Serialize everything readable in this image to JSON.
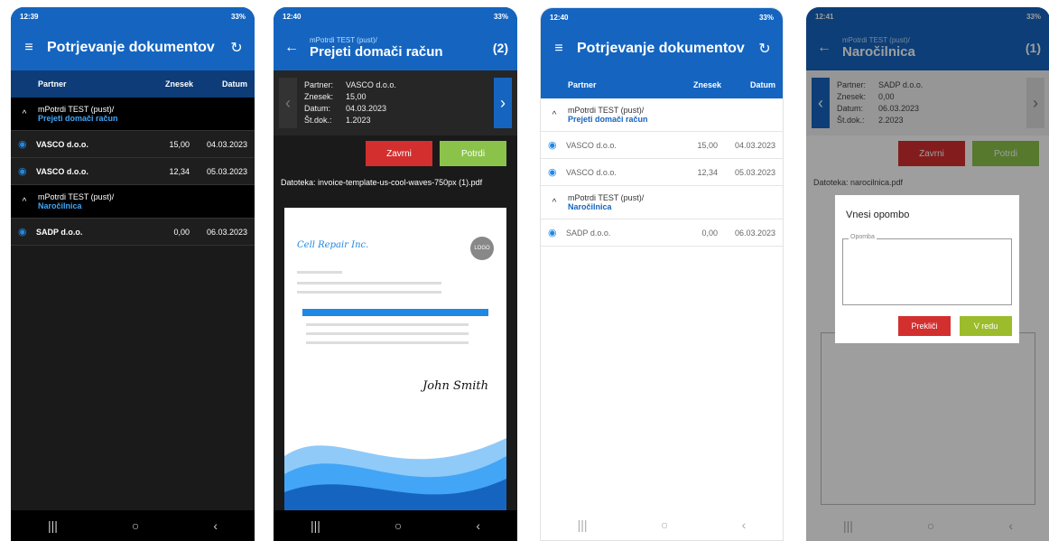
{
  "phone1": {
    "status_time": "12:39",
    "status_right": "33%",
    "title": "Potrjevanje dokumentov",
    "columns": [
      "Partner",
      "Znesek",
      "Datum"
    ],
    "groups": [
      {
        "line1": "mPotrdi TEST (pust)/",
        "line2": "Prejeti domači račun",
        "rows": [
          {
            "partner": "VASCO d.o.o.",
            "amount": "15,00",
            "date": "04.03.2023"
          },
          {
            "partner": "VASCO d.o.o.",
            "amount": "12,34",
            "date": "05.03.2023"
          }
        ]
      },
      {
        "line1": "mPotrdi TEST (pust)/",
        "line2": "Naročilnica",
        "rows": [
          {
            "partner": "SADP d.o.o.",
            "amount": "0,00",
            "date": "06.03.2023"
          }
        ]
      }
    ]
  },
  "phone2": {
    "status_time": "12:40",
    "status_right": "33%",
    "sub": "mPotrdi TEST (pust)/",
    "title": "Prejeti domači račun",
    "count": "(2)",
    "fields": {
      "partner_k": "Partner:",
      "partner_v": "VASCO d.o.o.",
      "amount_k": "Znesek:",
      "amount_v": "15,00",
      "date_k": "Datum:",
      "date_v": "04.03.2023",
      "doc_k": "Št.dok.:",
      "doc_v": "1.2023"
    },
    "btn_reject": "Zavrni",
    "btn_confirm": "Potrdi",
    "file": "Datoteka: invoice-template-us-cool-waves-750px (1).pdf",
    "invoice_title": "Cell Repair Inc.",
    "invoice_logo": "LOGO",
    "invoice_sign": "John Smith"
  },
  "phone3": {
    "status_time": "12:40",
    "status_right": "33%",
    "title": "Potrjevanje dokumentov",
    "columns": [
      "Partner",
      "Znesek",
      "Datum"
    ],
    "groups": [
      {
        "line1": "mPotrdi TEST (pust)/",
        "line2": "Prejeti domači račun",
        "rows": [
          {
            "partner": "VASCO d.o.o.",
            "amount": "15,00",
            "date": "04.03.2023"
          },
          {
            "partner": "VASCO d.o.o.",
            "amount": "12,34",
            "date": "05.03.2023"
          }
        ]
      },
      {
        "line1": "mPotrdi TEST (pust)/",
        "line2": "Naročilnica",
        "rows": [
          {
            "partner": "SADP d.o.o.",
            "amount": "0,00",
            "date": "06.03.2023"
          }
        ]
      }
    ]
  },
  "phone4": {
    "status_time": "12:41",
    "status_right": "33%",
    "sub": "mPotrdi TEST (pust)/",
    "title": "Naročilnica",
    "count": "(1)",
    "fields": {
      "partner_k": "Partner:",
      "partner_v": "SADP d.o.o.",
      "amount_k": "Znesek:",
      "amount_v": "0,00",
      "date_k": "Datum:",
      "date_v": "06.03.2023",
      "doc_k": "Št.dok.:",
      "doc_v": "2.2023"
    },
    "btn_reject": "Zavrni",
    "btn_confirm": "Potrdi",
    "file": "Datoteka: narocilnica.pdf",
    "dialog_title": "Vnesi opombo",
    "dialog_field_label": "Opomba",
    "dialog_cancel": "Prekliči",
    "dialog_ok": "V redu"
  },
  "nav": {
    "recent": "|||",
    "home": "○",
    "back": "‹"
  },
  "colors": {
    "primary": "#1565c0",
    "reject": "#d32f2f",
    "confirm": "#8bc34a"
  }
}
